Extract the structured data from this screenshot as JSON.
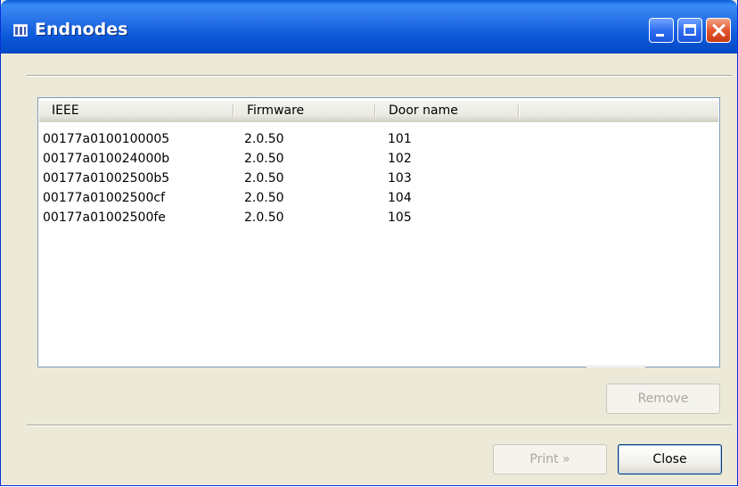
{
  "window": {
    "title": "Endnodes"
  },
  "list": {
    "columns": [
      "IEEE",
      "Firmware",
      "Door name"
    ],
    "rows": [
      {
        "ieee": "00177a0100100005",
        "firmware": "2.0.50",
        "door": "101"
      },
      {
        "ieee": "00177a010024000b",
        "firmware": "2.0.50",
        "door": "102"
      },
      {
        "ieee": "00177a01002500b5",
        "firmware": "2.0.50",
        "door": "103"
      },
      {
        "ieee": "00177a01002500cf",
        "firmware": "2.0.50",
        "door": "104"
      },
      {
        "ieee": "00177a01002500fe",
        "firmware": "2.0.50",
        "door": "105"
      }
    ]
  },
  "buttons": {
    "remove": "Remove",
    "print": "Print »",
    "close": "Close"
  },
  "icons": {
    "app": "table-icon",
    "minimize": "minimize-icon",
    "maximize": "maximize-icon",
    "close": "close-icon"
  },
  "colors": {
    "titlebar": "#0a58d8",
    "close_button": "#e4572e",
    "dialog_bg": "#ece9d8"
  }
}
